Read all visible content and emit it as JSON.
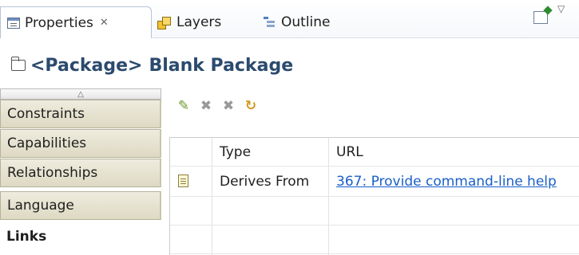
{
  "tabs": [
    {
      "label": "Properties",
      "icon": "properties-icon",
      "active": true
    },
    {
      "label": "Layers",
      "icon": "layers-icon"
    },
    {
      "label": "Outline",
      "icon": "outline-icon"
    }
  ],
  "tab_close_glyph": "✕",
  "header": {
    "stereotype": "<Package>",
    "name": "Blank Package",
    "icon": "package-icon"
  },
  "left_tabs": [
    {
      "label": "Constraints"
    },
    {
      "label": "Capabilities"
    },
    {
      "label": "Relationships"
    },
    {
      "label": "Language"
    },
    {
      "label": "Links",
      "active": true
    }
  ],
  "toolbar": [
    {
      "icon": "add-link-icon"
    },
    {
      "icon": "delete-icon"
    },
    {
      "icon": "delete-all-icon"
    },
    {
      "icon": "refresh-icon"
    }
  ],
  "table": {
    "columns": [
      "",
      "Type",
      "URL"
    ],
    "rows": [
      {
        "icon": "document-icon",
        "type": "Derives From",
        "url": "367: Provide command-line help"
      }
    ]
  },
  "colors": {
    "title": "#2b4a6e",
    "link": "#1a5fc7",
    "left_tab_bg": "#ddd9c3"
  }
}
